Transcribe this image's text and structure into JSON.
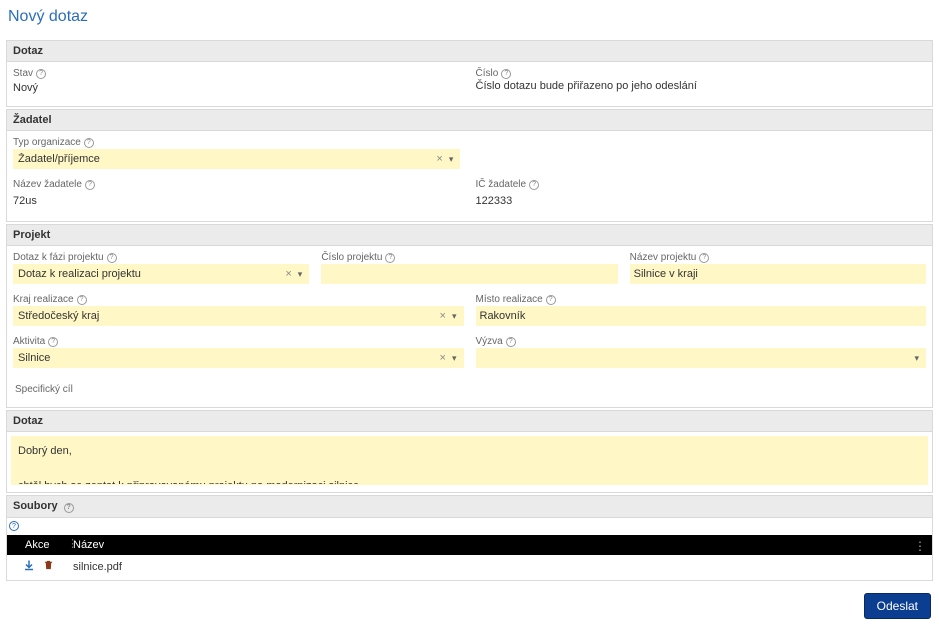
{
  "page": {
    "title": "Nový dotaz"
  },
  "sections": {
    "dotaz_head": "Dotaz",
    "zadatel_head": "Žadatel",
    "projekt_head": "Projekt",
    "dotaz2_head": "Dotaz",
    "soubory_head": "Soubory"
  },
  "fields": {
    "stav_label": "Stav",
    "stav_value": "Nový",
    "cislo_label": "Číslo",
    "cislo_hint": "Číslo dotazu bude přiřazeno po jeho odeslání",
    "typorg_label": "Typ organizace",
    "typorg_value": "Žadatel/příjemce",
    "nazev_zad_label": "Název žadatele",
    "nazev_zad_value": "72us",
    "ic_label": "IČ žadatele",
    "ic_value": "122333",
    "faze_label": "Dotaz k fázi projektu",
    "faze_value": "Dotaz k realizaci projektu",
    "cislo_proj_label": "Číslo projektu",
    "cislo_proj_value": "",
    "nazev_proj_label": "Název projektu",
    "nazev_proj_value": "Silnice v kraji",
    "kraj_label": "Kraj realizace",
    "kraj_value": "Středočeský kraj",
    "misto_label": "Místo realizace",
    "misto_value": "Rakovník",
    "aktivita_label": "Aktivita",
    "aktivita_value": "Silnice",
    "vyzva_label": "Výzva",
    "vyzva_value": "",
    "spec_label": "Specifický cíl",
    "text_value": "Dobrý den,\n\nchtěl bych se zeptat k připravovanému projektu na modernizaci silnice......."
  },
  "files": {
    "col_actions": "Akce",
    "col_name": "Název",
    "rows": [
      {
        "name": "silnice.pdf"
      }
    ]
  },
  "buttons": {
    "submit": "Odeslat"
  },
  "glyphs": {
    "help": "?",
    "clear": "×",
    "caret": "▾",
    "sep": "⋮",
    "menu": "⋮"
  }
}
